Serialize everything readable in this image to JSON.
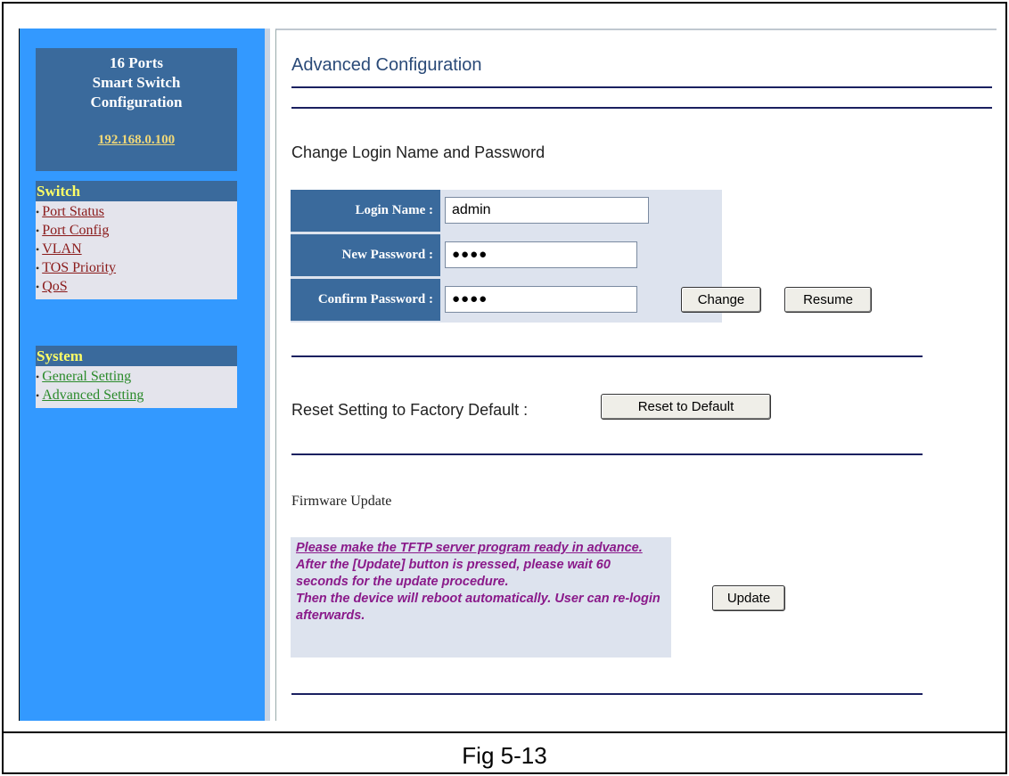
{
  "sidebar": {
    "brand_line1": "16 Ports",
    "brand_line2": "Smart Switch",
    "brand_line3": "Configuration",
    "ip": "192.168.0.100",
    "switch_group": {
      "title": "Switch",
      "items": [
        "Port Status",
        "Port Config",
        "VLAN",
        "TOS Priority",
        "QoS"
      ]
    },
    "system_group": {
      "title": "System",
      "items": [
        "General Setting",
        "Advanced Setting"
      ]
    }
  },
  "main": {
    "title": "Advanced Configuration",
    "login_section": {
      "heading": "Change Login Name and Password",
      "login_name_label": "Login Name :",
      "login_name_value": "admin",
      "new_password_label": "New Password :",
      "new_password_value": "●●●●",
      "confirm_password_label": "Confirm Password :",
      "confirm_password_value": "●●●●",
      "change_button": "Change",
      "resume_button": "Resume"
    },
    "reset_section": {
      "label": "Reset Setting to Factory Default :",
      "button": "Reset to Default"
    },
    "firmware_section": {
      "heading": "Firmware Update",
      "note_line1": "Please make the TFTP server program ready in advance.",
      "note_line2": "After the [Update] button is pressed, please wait 60 seconds for the update procedure.",
      "note_line3": "Then the device will reboot automatically. User can re-login afterwards.",
      "update_button": "Update"
    }
  },
  "caption": "Fig 5-13",
  "colors": {
    "sidebar_bg": "#3399ff",
    "panel_bg": "#3a6a9c",
    "menu_bg": "#e4e4ec",
    "rule": "#1a2060",
    "note_text": "#8a1a8a"
  }
}
